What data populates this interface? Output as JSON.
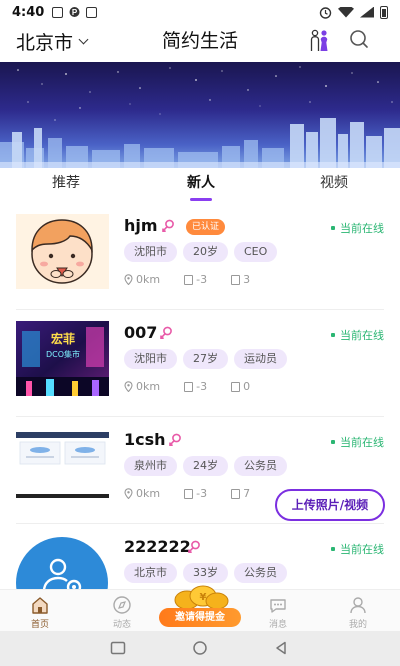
{
  "status_bar": {
    "time": "4:40",
    "icons": [
      "image-icon",
      "p-icon",
      "sim-icon"
    ],
    "right_icons": [
      "alarm-icon",
      "wifi-icon",
      "signal-icon",
      "battery-icon"
    ]
  },
  "header": {
    "city": "北京市",
    "title": "简约生活"
  },
  "tabs": [
    {
      "label": "推荐",
      "active": false
    },
    {
      "label": "新人",
      "active": true
    },
    {
      "label": "视频",
      "active": false
    }
  ],
  "users": [
    {
      "name": "hjm",
      "verified": "已认证",
      "online": "当前在线",
      "tags": [
        "沈阳市",
        "20岁",
        "CEO"
      ],
      "distance": "0km",
      "photos": "-3",
      "videos": "3",
      "avatar": "cartoon-boy"
    },
    {
      "name": "007",
      "verified": "",
      "online": "当前在线",
      "tags": [
        "沈阳市",
        "27岁",
        "运动员"
      ],
      "distance": "0km",
      "photos": "-3",
      "videos": "0",
      "avatar": "neon-poster"
    },
    {
      "name": "1csh",
      "verified": "",
      "online": "当前在线",
      "tags": [
        "泉州市",
        "24岁",
        "公务员"
      ],
      "distance": "0km",
      "photos": "-3",
      "videos": "7",
      "avatar": "screenshot"
    },
    {
      "name": "222222",
      "verified": "",
      "online": "当前在线",
      "tags": [
        "北京市",
        "33岁",
        "公务员"
      ],
      "distance": "",
      "photos": "",
      "videos": "",
      "avatar": "settings-user"
    }
  ],
  "thumb_text": {
    "poster_title": "宏菲",
    "poster_sub": "DCO集市"
  },
  "upload_button": "上传照片/视频",
  "bottom_nav": [
    {
      "label": "首页",
      "icon": "home-icon",
      "active": true
    },
    {
      "label": "动态",
      "icon": "compass-icon",
      "active": false
    },
    {
      "label": "消息",
      "icon": "chat-icon",
      "active": false
    },
    {
      "label": "我的",
      "icon": "profile-icon",
      "active": false
    }
  ],
  "invite": "邀请得提金",
  "colors": {
    "accent": "#8a3ef0",
    "online": "#2bb673",
    "tag_bg": "#efe7fb",
    "verified": "#ff8a3d",
    "invite": "#ff7a1a"
  }
}
